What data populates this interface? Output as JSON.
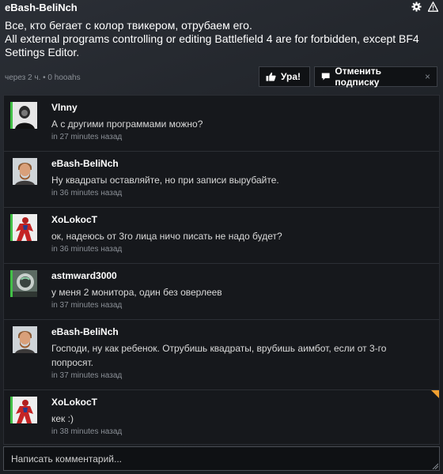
{
  "header": {
    "author": "eBash-BeliNch",
    "text_line1": "Все, кто бегает с колор твикером, отрубаем его.",
    "text_line2": "All external programs controlling or editing Battlefield 4 are for forbidden, except BF4 Settings Editor.",
    "meta": "через 2 ч. • 0 hooahs",
    "icons": [
      "gear-icon",
      "warning-icon"
    ]
  },
  "actions": {
    "ura_label": "Ура!",
    "ura_icon": "thumbs-up-icon",
    "unsubscribe_label": "Отменить подписку",
    "unsubscribe_icon": "comment-icon",
    "close_glyph": "×"
  },
  "comments": [
    {
      "author": "Vlnny",
      "text": "А с другими программами можно?",
      "time": "in 27 minutes назад",
      "online": true
    },
    {
      "author": "eBash-BeliNch",
      "text": "Ну квадраты оставляйте, но при записи вырубайте.",
      "time": "in 36 minutes назад",
      "online": false
    },
    {
      "author": "XoLokocT",
      "text": "ок, надеюсь от 3го лица ничо писать не надо будет?",
      "time": "in 36 minutes назад",
      "online": true
    },
    {
      "author": "astmward3000",
      "text": "у меня 2 монитора, один без оверлеев",
      "time": "in 37 minutes назад",
      "online": true
    },
    {
      "author": "eBash-BeliNch",
      "text": "Господи, ну как ребенок. Отрубишь квадраты, врубишь аимбот, если от 3-го попросят.",
      "time": "in 37 minutes назад",
      "online": false
    },
    {
      "author": "XoLokocT",
      "text": "кек :)",
      "time": "in 38 minutes назад",
      "online": true
    }
  ],
  "comment_input": {
    "placeholder": "Написать комментарий..."
  },
  "colors": {
    "online": "#42c047",
    "new_marker": "#f0a030",
    "background": "#1c1f24"
  }
}
